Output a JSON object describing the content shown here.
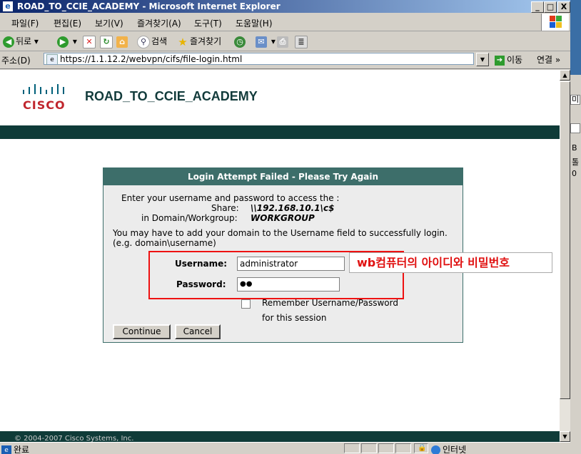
{
  "window": {
    "title": "ROAD_TO_CCIE_ACADEMY - Microsoft Internet Explorer",
    "min": "_",
    "max": "□",
    "close": "X"
  },
  "menu": [
    "파일(F)",
    "편집(E)",
    "보기(V)",
    "즐겨찾기(A)",
    "도구(T)",
    "도움말(H)"
  ],
  "toolbar": {
    "back": "뒤로",
    "search": "검색",
    "favorites": "즐겨찾기"
  },
  "address": {
    "label": "주소(D)",
    "url": "https://1.1.12.2/webvpn/cifs/file-login.html",
    "go": "이동",
    "links": "연결"
  },
  "header": {
    "logo_text": "CISCO",
    "brand": "ROAD_TO_CCIE_ACADEMY"
  },
  "login": {
    "heading": "Login Attempt Failed - Please Try Again",
    "intro": "Enter your username and password to access the :",
    "share_label": "Share:",
    "share_value": "\\\\192.168.10.1\\c$",
    "domain_label": "in Domain/Workgroup:",
    "domain_value": "WORKGROUP",
    "hint1": "You may have to add your domain to the Username field to successfully login.",
    "hint2": "(e.g. domain\\username)",
    "username_label": "Username:",
    "username_value": "administrator",
    "password_label": "Password:",
    "password_value": "●●",
    "remember1": "Remember Username/Password",
    "remember2": "for this session",
    "continue": "Continue",
    "cancel": "Cancel"
  },
  "annotation": {
    "text": "wb컴퓨터의 아이디와 비밀번호"
  },
  "footer": {
    "copyright": "© 2004-2007 Cisco Systems, Inc."
  },
  "status": {
    "left": "완료",
    "zone": "인터넷"
  },
  "colors": {
    "title_bar": "#0a246a",
    "panel_header": "#3d6e6a",
    "band": "#0f3b38",
    "annotation_red": "#e01010"
  }
}
